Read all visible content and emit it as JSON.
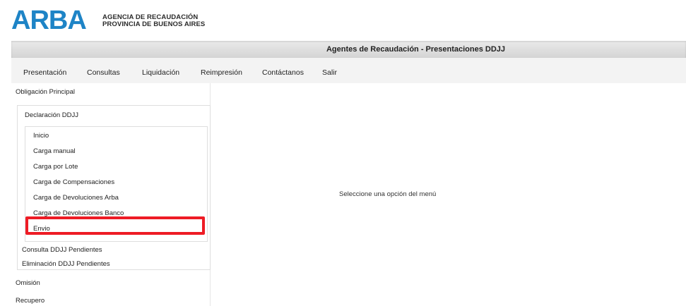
{
  "header": {
    "logo": "ARBA",
    "agency_line1": "AGENCIA DE RECAUDACIÓN",
    "agency_line2": "PROVINCIA DE BUENOS AIRES"
  },
  "titlebar": {
    "title": "Agentes de Recaudación - Presentaciones DDJJ"
  },
  "menu": {
    "items": [
      "Presentación",
      "Consultas",
      "Liquidación",
      "Reimpresión",
      "Contáctanos",
      "Salir"
    ]
  },
  "sidebar": {
    "obligacion_principal": "Obligación Principal",
    "declaracion_ddjj": "Declaración DDJJ",
    "submenu": [
      "Inicio",
      "Carga manual",
      "Carga por Lote",
      "Carga de Compensaciones",
      "Carga de Devoluciones Arba",
      "Carga de Devoluciones Banco",
      "Envio"
    ],
    "consulta_pendientes": "Consulta DDJJ Pendientes",
    "eliminacion_pendientes": "Eliminación DDJJ Pendientes",
    "omision": "Omisión",
    "recupero": "Recupero",
    "highlight_color": "#ee1c25"
  },
  "content": {
    "message": "Seleccione una opción del menú"
  },
  "colors": {
    "brand": "#1e84c6",
    "titlebar": "#dcdcdc",
    "menubar": "#f3f3f3"
  }
}
